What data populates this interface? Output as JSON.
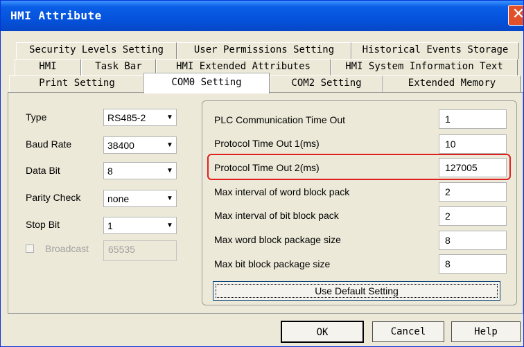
{
  "window": {
    "title": "HMI Attribute",
    "close_glyph": "✕"
  },
  "tabs": {
    "row1": [
      "Security Levels Setting",
      "User Permissions Setting",
      "Historical Events Storage"
    ],
    "row2": [
      "HMI",
      "Task Bar",
      "HMI Extended Attributes",
      "HMI System Information Text"
    ],
    "row3": [
      "Print Setting",
      "COM0 Setting",
      "COM2 Setting",
      "Extended Memory"
    ],
    "active": "COM0 Setting"
  },
  "serial": {
    "type_label": "Type",
    "type_value": "RS485-2",
    "baud_label": "Baud Rate",
    "baud_value": "38400",
    "databit_label": "Data Bit",
    "databit_value": "8",
    "parity_label": "Parity Check",
    "parity_value": "none",
    "stopbit_label": "Stop Bit",
    "stopbit_value": "1",
    "broadcast_label": "Broadcast",
    "broadcast_value": "65535"
  },
  "comm": {
    "items": [
      {
        "label": "PLC Communication Time Out",
        "value": "1"
      },
      {
        "label": "Protocol Time Out 1(ms)",
        "value": "10"
      },
      {
        "label": "Protocol Time Out 2(ms)",
        "value": "127005"
      },
      {
        "label": "Max interval of word block pack",
        "value": "2"
      },
      {
        "label": "Max interval of bit block pack",
        "value": "2"
      },
      {
        "label": "Max word block package size",
        "value": "8"
      },
      {
        "label": "Max bit block package size",
        "value": "8"
      }
    ],
    "default_button": "Use Default Setting"
  },
  "buttons": {
    "ok": "OK",
    "cancel": "Cancel",
    "help": "Help"
  },
  "colors": {
    "titlebar": "#0553dd",
    "highlight": "#e02020",
    "close": "#e2502a"
  }
}
